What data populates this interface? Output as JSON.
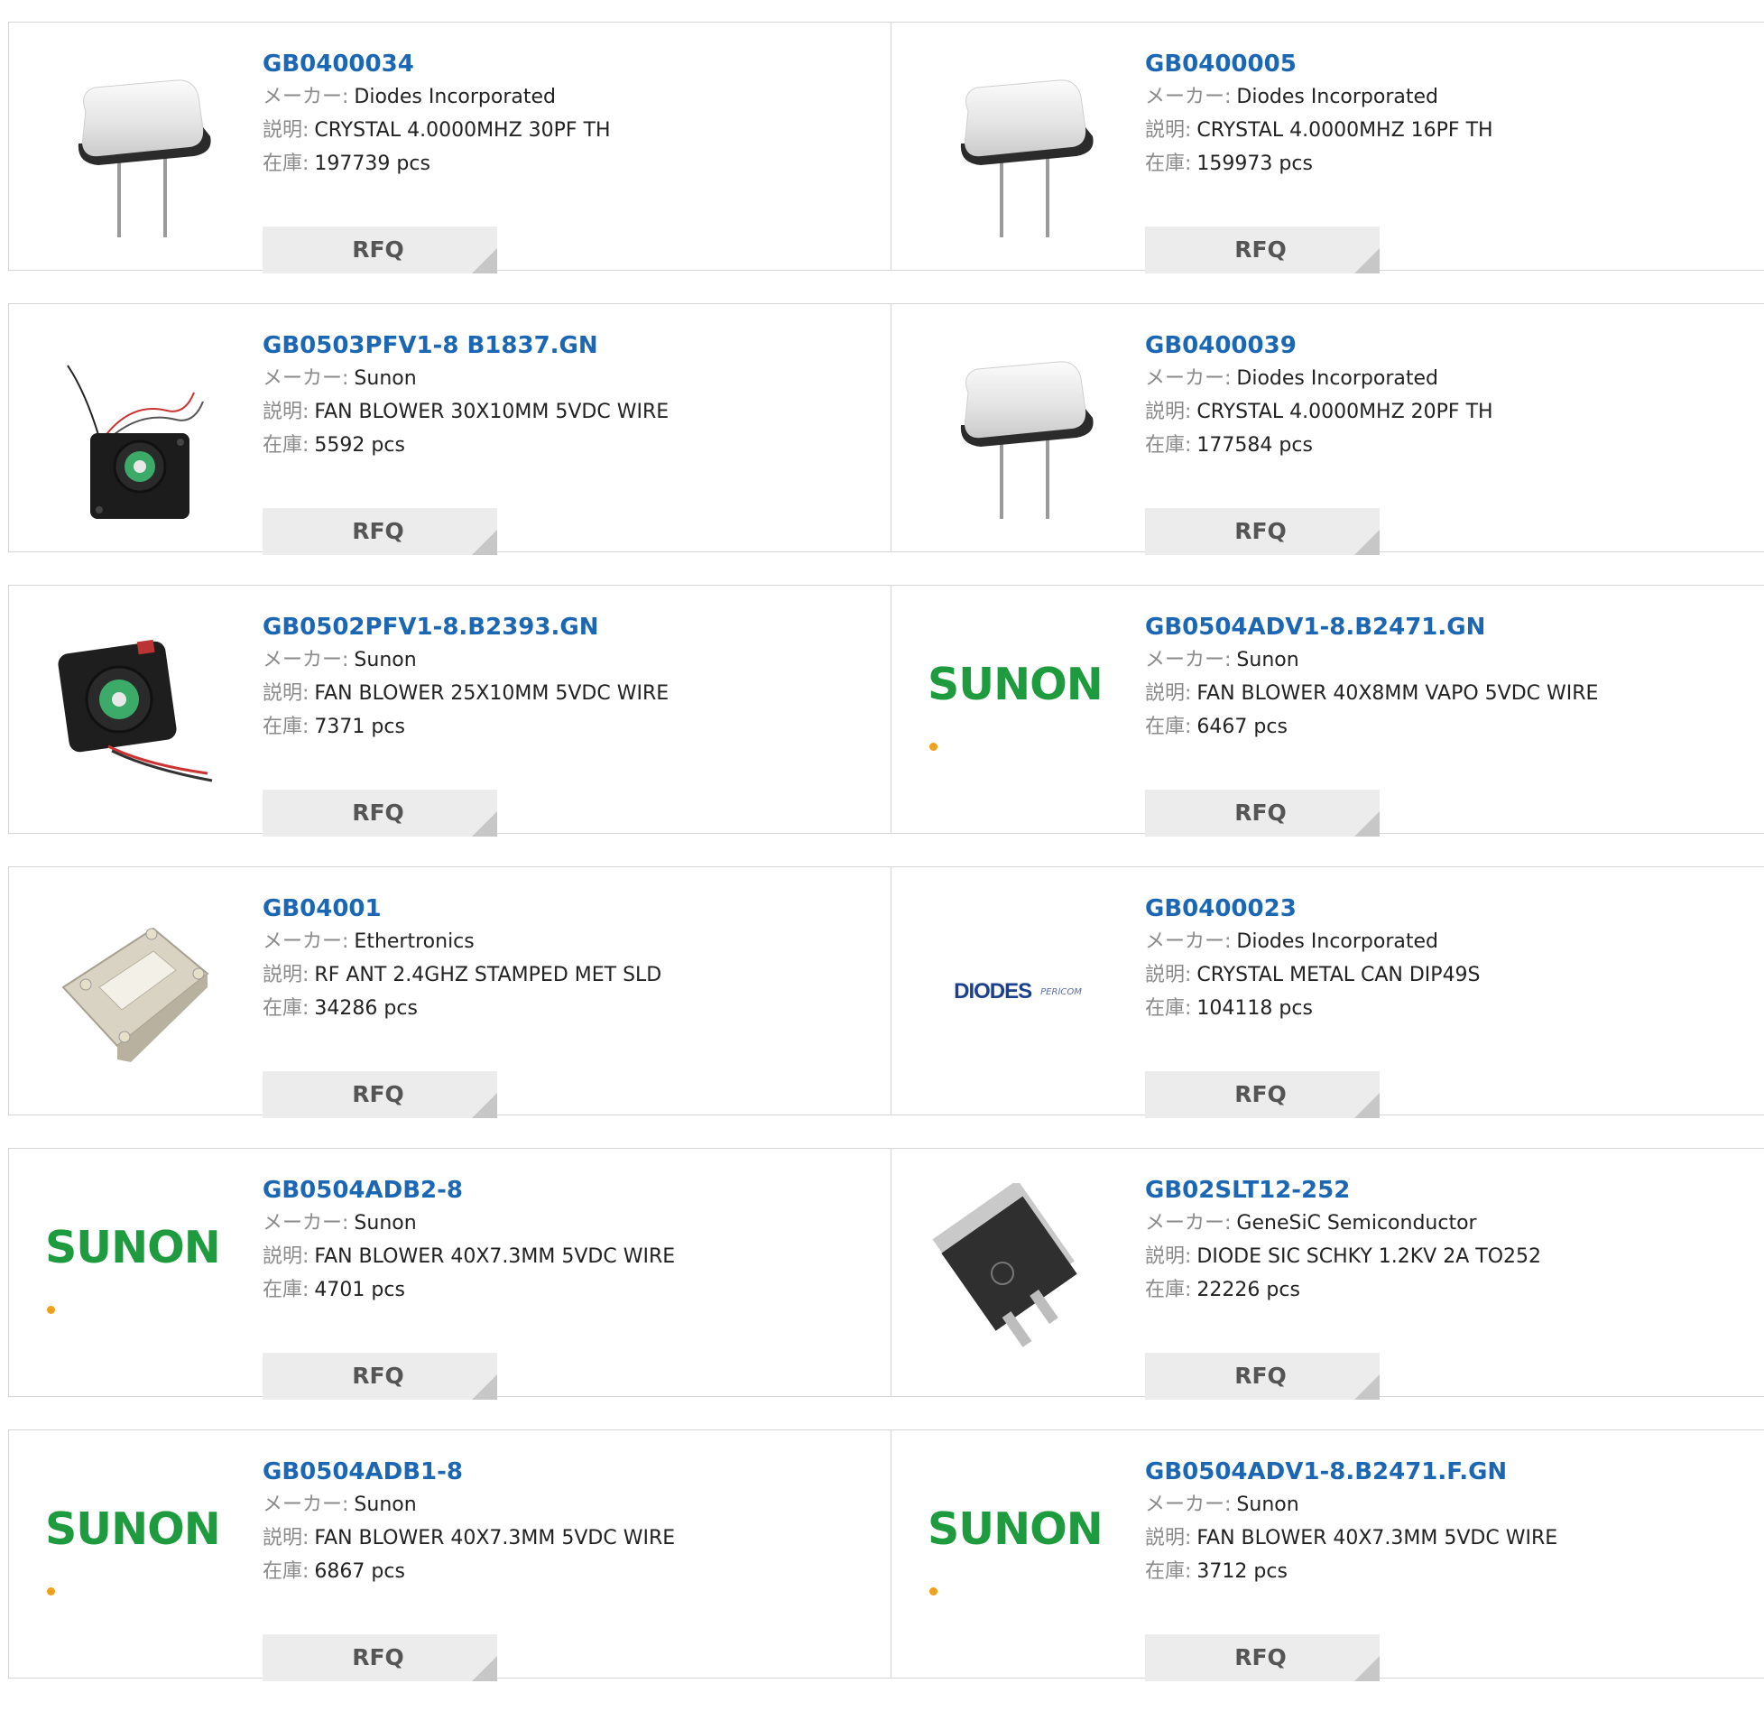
{
  "labels": {
    "maker": "メーカー:",
    "desc": "説明:",
    "stock": "在庫:",
    "rfq": "RFQ"
  },
  "brand_colors": {
    "link": "#1b67b3",
    "sunon_green": "#1e9a3f",
    "diodes_blue": "#1d3f8f"
  },
  "logos": {
    "sunon": "SUNON",
    "diodes": "DIODES",
    "pericom": "PERICOM"
  },
  "products": [
    {
      "part": "GB0400034",
      "maker": "Diodes Incorporated",
      "desc": "CRYSTAL 4.0000MHZ 30PF TH",
      "stock": "197739 pcs",
      "image": "crystal"
    },
    {
      "part": "GB0400005",
      "maker": "Diodes Incorporated",
      "desc": "CRYSTAL 4.0000MHZ 16PF TH",
      "stock": "159973 pcs",
      "image": "crystal"
    },
    {
      "part": "GB0503PFV1-8 B1837.GN",
      "maker": "Sunon",
      "desc": "FAN BLOWER 30X10MM 5VDC WIRE",
      "stock": "5592 pcs",
      "image": "fan-wire-up"
    },
    {
      "part": "GB0400039",
      "maker": "Diodes Incorporated",
      "desc": "CRYSTAL 4.0000MHZ 20PF TH",
      "stock": "177584 pcs",
      "image": "crystal"
    },
    {
      "part": "GB0502PFV1-8.B2393.GN",
      "maker": "Sunon",
      "desc": "FAN BLOWER 25X10MM 5VDC WIRE",
      "stock": "7371 pcs",
      "image": "fan-wire-down"
    },
    {
      "part": "GB0504ADV1-8.B2471.GN",
      "maker": "Sunon",
      "desc": "FAN BLOWER 40X8MM VAPO 5VDC WIRE",
      "stock": "6467 pcs",
      "image": "sunon-logo"
    },
    {
      "part": "GB04001",
      "maker": "Ethertronics",
      "desc": "RF ANT 2.4GHZ STAMPED MET SLD",
      "stock": "34286 pcs",
      "image": "antenna"
    },
    {
      "part": "GB0400023",
      "maker": "Diodes Incorporated",
      "desc": "CRYSTAL METAL CAN DIP49S",
      "stock": "104118 pcs",
      "image": "diodes-logo"
    },
    {
      "part": "GB0504ADB2-8",
      "maker": "Sunon",
      "desc": "FAN BLOWER 40X7.3MM 5VDC WIRE",
      "stock": "4701 pcs",
      "image": "sunon-logo"
    },
    {
      "part": "GB02SLT12-252",
      "maker": "GeneSiC Semiconductor",
      "desc": "DIODE SIC SCHKY 1.2KV 2A TO252",
      "stock": "22226 pcs",
      "image": "to252"
    },
    {
      "part": "GB0504ADB1-8",
      "maker": "Sunon",
      "desc": "FAN BLOWER 40X7.3MM 5VDC WIRE",
      "stock": "6867 pcs",
      "image": "sunon-logo"
    },
    {
      "part": "GB0504ADV1-8.B2471.F.GN",
      "maker": "Sunon",
      "desc": "FAN BLOWER 40X7.3MM 5VDC WIRE",
      "stock": "3712 pcs",
      "image": "sunon-logo"
    }
  ]
}
